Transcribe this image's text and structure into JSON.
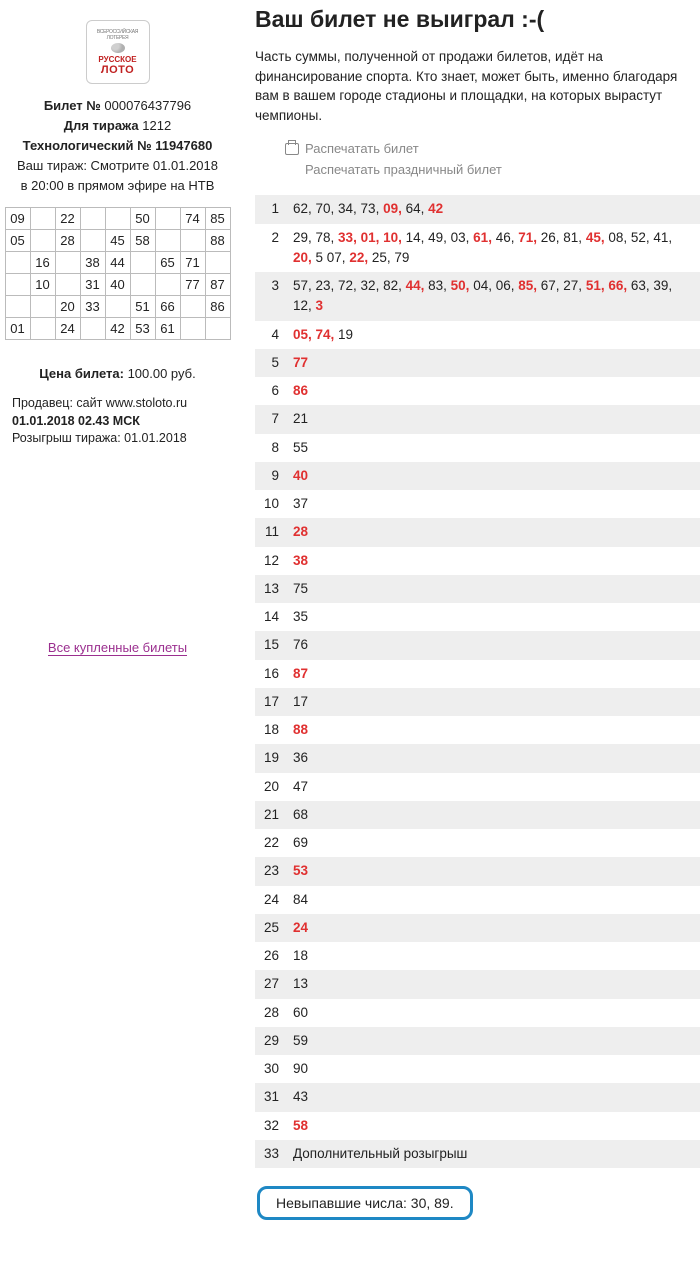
{
  "sidebar": {
    "logo": {
      "top": "ВСЕРОССИЙСКАЯ ЛОТЕРЕЯ",
      "line1": "РУССКОЕ",
      "line2": "ЛОТО"
    },
    "ticket_label": "Билет №",
    "ticket_no": "000076437796",
    "draw_label": "Для тиража",
    "draw_no": "1212",
    "tech_label": "Технологический №",
    "tech_no": "11947680",
    "watch1": "Ваш тираж: Смотрите 01.01.2018",
    "watch2": "в 20:00 в прямом эфире на НТВ",
    "grid": [
      [
        "09",
        "",
        "22",
        "",
        "",
        "50",
        "",
        "74",
        "85"
      ],
      [
        "05",
        "",
        "28",
        "",
        "45",
        "58",
        "",
        "",
        "88"
      ],
      [
        "",
        "16",
        "",
        "38",
        "44",
        "",
        "65",
        "71",
        ""
      ],
      [
        "",
        "10",
        "",
        "31",
        "40",
        "",
        "",
        "77",
        "87"
      ],
      [
        "",
        "",
        "20",
        "33",
        "",
        "51",
        "66",
        "",
        "86"
      ],
      [
        "01",
        "",
        "24",
        "",
        "42",
        "53",
        "61",
        "",
        ""
      ]
    ],
    "price_label": "Цена билета:",
    "price_value": "100.00 руб.",
    "seller": "Продавец: сайт www.stoloto.ru",
    "purchase": "01.01.2018   02.43 МСК",
    "draw_date": "Розыгрыш тиража: 01.01.2018",
    "all_tickets": "Все купленные билеты"
  },
  "main": {
    "title": "Ваш билет не выиграл :-(",
    "desc": "Часть суммы, полученной от продажи билетов, идёт на финансирование спорта. Кто знает, может быть, именно благодаря вам в вашем городе стадионы и площадки, на которых вырастут чемпионы.",
    "print1": "Распечатать билет",
    "print2": "Распечатать праздничный билет",
    "rows": [
      {
        "n": "1",
        "vals": [
          {
            "t": "62, 70, 34, 73, "
          },
          {
            "t": "09,",
            "h": true
          },
          {
            "t": " 64, "
          },
          {
            "t": "42",
            "h": true
          }
        ]
      },
      {
        "n": "2",
        "vals": [
          {
            "t": "29, 78, "
          },
          {
            "t": "33, 01, 10,",
            "h": true
          },
          {
            "t": " 14, 49, 03, "
          },
          {
            "t": "61,",
            "h": true
          },
          {
            "t": " 46, "
          },
          {
            "t": "71,",
            "h": true
          },
          {
            "t": " 26, 81, "
          },
          {
            "t": "45,",
            "h": true
          },
          {
            "t": " 08, 52, 41, "
          },
          {
            "t": "20,",
            "h": true
          },
          {
            "t": " 5 07, "
          },
          {
            "t": "22,",
            "h": true
          },
          {
            "t": " 25, 79"
          }
        ]
      },
      {
        "n": "3",
        "vals": [
          {
            "t": "57, 23, 72, 32, 82, "
          },
          {
            "t": "44,",
            "h": true
          },
          {
            "t": " 83, "
          },
          {
            "t": "50,",
            "h": true
          },
          {
            "t": " 04, 06, "
          },
          {
            "t": "85,",
            "h": true
          },
          {
            "t": " 67, 27, "
          },
          {
            "t": "51, 66,",
            "h": true
          },
          {
            "t": " 63, 39, 12, "
          },
          {
            "t": "3",
            "h": true
          }
        ]
      },
      {
        "n": "4",
        "vals": [
          {
            "t": "05, 74,",
            "h": true
          },
          {
            "t": " 19"
          }
        ]
      },
      {
        "n": "5",
        "vals": [
          {
            "t": "77",
            "h": true
          }
        ]
      },
      {
        "n": "6",
        "vals": [
          {
            "t": "86",
            "h": true
          }
        ]
      },
      {
        "n": "7",
        "vals": [
          {
            "t": "21"
          }
        ]
      },
      {
        "n": "8",
        "vals": [
          {
            "t": "55"
          }
        ]
      },
      {
        "n": "9",
        "vals": [
          {
            "t": "40",
            "h": true
          }
        ]
      },
      {
        "n": "10",
        "vals": [
          {
            "t": "37"
          }
        ]
      },
      {
        "n": "11",
        "vals": [
          {
            "t": "28",
            "h": true
          }
        ]
      },
      {
        "n": "12",
        "vals": [
          {
            "t": "38",
            "h": true
          }
        ]
      },
      {
        "n": "13",
        "vals": [
          {
            "t": "75"
          }
        ]
      },
      {
        "n": "14",
        "vals": [
          {
            "t": "35"
          }
        ]
      },
      {
        "n": "15",
        "vals": [
          {
            "t": "76"
          }
        ]
      },
      {
        "n": "16",
        "vals": [
          {
            "t": "87",
            "h": true
          }
        ]
      },
      {
        "n": "17",
        "vals": [
          {
            "t": "17"
          }
        ]
      },
      {
        "n": "18",
        "vals": [
          {
            "t": "88",
            "h": true
          }
        ]
      },
      {
        "n": "19",
        "vals": [
          {
            "t": "36"
          }
        ]
      },
      {
        "n": "20",
        "vals": [
          {
            "t": "47"
          }
        ]
      },
      {
        "n": "21",
        "vals": [
          {
            "t": "68"
          }
        ]
      },
      {
        "n": "22",
        "vals": [
          {
            "t": "69"
          }
        ]
      },
      {
        "n": "23",
        "vals": [
          {
            "t": "53",
            "h": true
          }
        ]
      },
      {
        "n": "24",
        "vals": [
          {
            "t": "84"
          }
        ]
      },
      {
        "n": "25",
        "vals": [
          {
            "t": "24",
            "h": true
          }
        ]
      },
      {
        "n": "26",
        "vals": [
          {
            "t": "18"
          }
        ]
      },
      {
        "n": "27",
        "vals": [
          {
            "t": "13"
          }
        ]
      },
      {
        "n": "28",
        "vals": [
          {
            "t": "60"
          }
        ]
      },
      {
        "n": "29",
        "vals": [
          {
            "t": "59"
          }
        ]
      },
      {
        "n": "30",
        "vals": [
          {
            "t": "90"
          }
        ]
      },
      {
        "n": "31",
        "vals": [
          {
            "t": "43"
          }
        ]
      },
      {
        "n": "32",
        "vals": [
          {
            "t": "58",
            "h": true
          }
        ]
      },
      {
        "n": "33",
        "vals": [
          {
            "t": "Дополнительный розыгрыш"
          }
        ]
      }
    ],
    "missing": "Невыпавшие числа: 30, 89."
  }
}
